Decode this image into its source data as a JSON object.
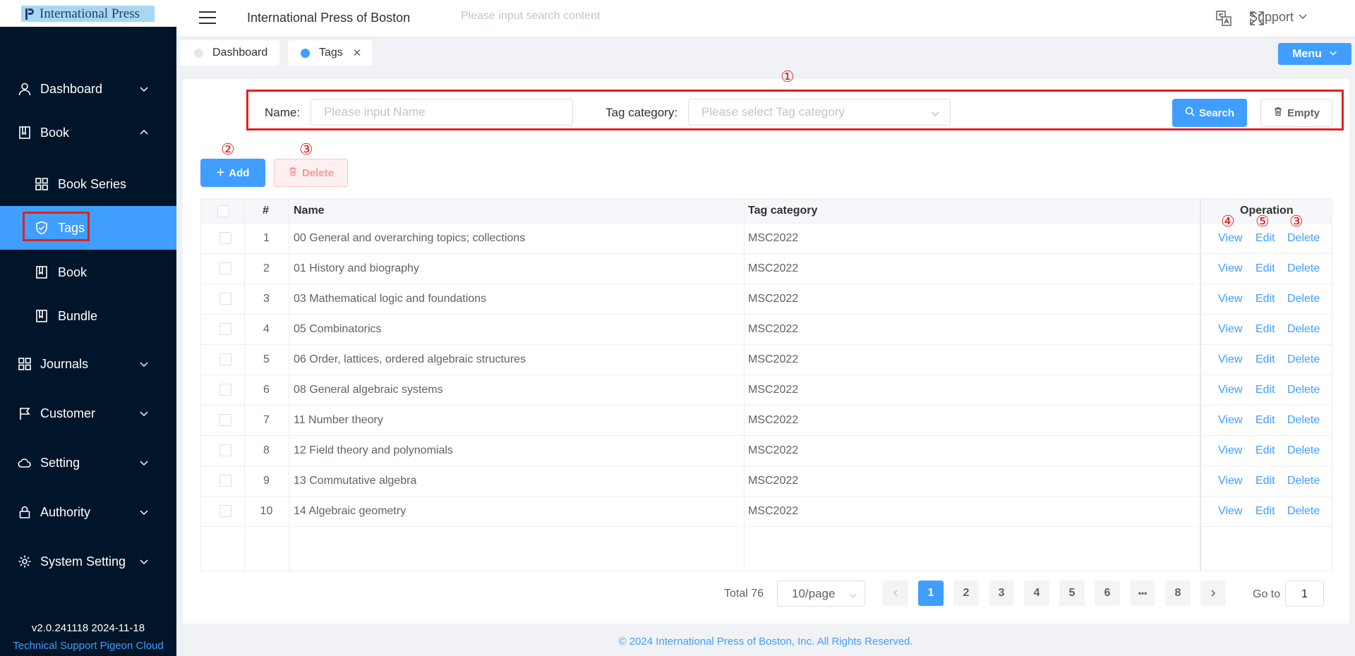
{
  "logo": {
    "text": "International Press"
  },
  "sidebar": {
    "items": [
      {
        "label": "Dashboard",
        "icon": "user-icon"
      },
      {
        "label": "Book",
        "icon": "book-icon"
      },
      {
        "label": "Book Series",
        "icon": "grid-icon"
      },
      {
        "label": "Tags",
        "icon": "shield-check-icon"
      },
      {
        "label": "Book",
        "icon": "book-icon"
      },
      {
        "label": "Bundle",
        "icon": "book-icon"
      },
      {
        "label": "Journals",
        "icon": "grid-icon"
      },
      {
        "label": "Customer",
        "icon": "flag-icon"
      },
      {
        "label": "Setting",
        "icon": "cloud-icon"
      },
      {
        "label": "Authority",
        "icon": "lock-icon"
      },
      {
        "label": "System Setting",
        "icon": "gear-icon"
      }
    ],
    "version": "v2.0.241118 2024-11-18",
    "support": "Technical Support Pigeon Cloud"
  },
  "header": {
    "title": "International Press of Boston",
    "search_placeholder": "Please input search content",
    "support_label": "Support"
  },
  "tabs": [
    {
      "label": "Dashboard",
      "active": false
    },
    {
      "label": "Tags",
      "active": true
    }
  ],
  "menu_button": "Menu",
  "annotations": {
    "a1": "①",
    "a2": "②",
    "a3": "③",
    "a4": "④",
    "a5": "⑤"
  },
  "filter": {
    "name_label": "Name:",
    "name_placeholder": "Please input Name",
    "category_label": "Tag category:",
    "category_placeholder": "Please select Tag category",
    "search_button": "Search",
    "empty_button": "Empty"
  },
  "actions": {
    "add": "Add",
    "delete": "Delete"
  },
  "table": {
    "columns": [
      "#",
      "Name",
      "Tag category",
      "Operation"
    ],
    "ops": {
      "view": "View",
      "edit": "Edit",
      "delete": "Delete"
    },
    "rows": [
      {
        "no": "1",
        "name": "00 General and overarching topics; collections",
        "category": "MSC2022"
      },
      {
        "no": "2",
        "name": "01 History and biography",
        "category": "MSC2022"
      },
      {
        "no": "3",
        "name": "03 Mathematical logic and foundations",
        "category": "MSC2022"
      },
      {
        "no": "4",
        "name": "05 Combinatorics",
        "category": "MSC2022"
      },
      {
        "no": "5",
        "name": "06 Order, lattices, ordered algebraic structures",
        "category": "MSC2022"
      },
      {
        "no": "6",
        "name": "08 General algebraic systems",
        "category": "MSC2022"
      },
      {
        "no": "7",
        "name": "11 Number theory",
        "category": "MSC2022"
      },
      {
        "no": "8",
        "name": "12 Field theory and polynomials",
        "category": "MSC2022"
      },
      {
        "no": "9",
        "name": "13 Commutative algebra",
        "category": "MSC2022"
      },
      {
        "no": "10",
        "name": "14 Algebraic geometry",
        "category": "MSC2022"
      }
    ]
  },
  "pagination": {
    "total": "Total 76",
    "page_size": "10/page",
    "pages": [
      "1",
      "2",
      "3",
      "4",
      "5",
      "6",
      "•••",
      "8"
    ],
    "current": "1",
    "goto_label": "Go to",
    "goto_value": "1"
  },
  "footer": "© 2024 International Press of Boston, Inc. All Rights Reserved.",
  "colors": {
    "sidebar_bg": "#001529",
    "accent": "#409eff",
    "annotation": "#e02020"
  }
}
